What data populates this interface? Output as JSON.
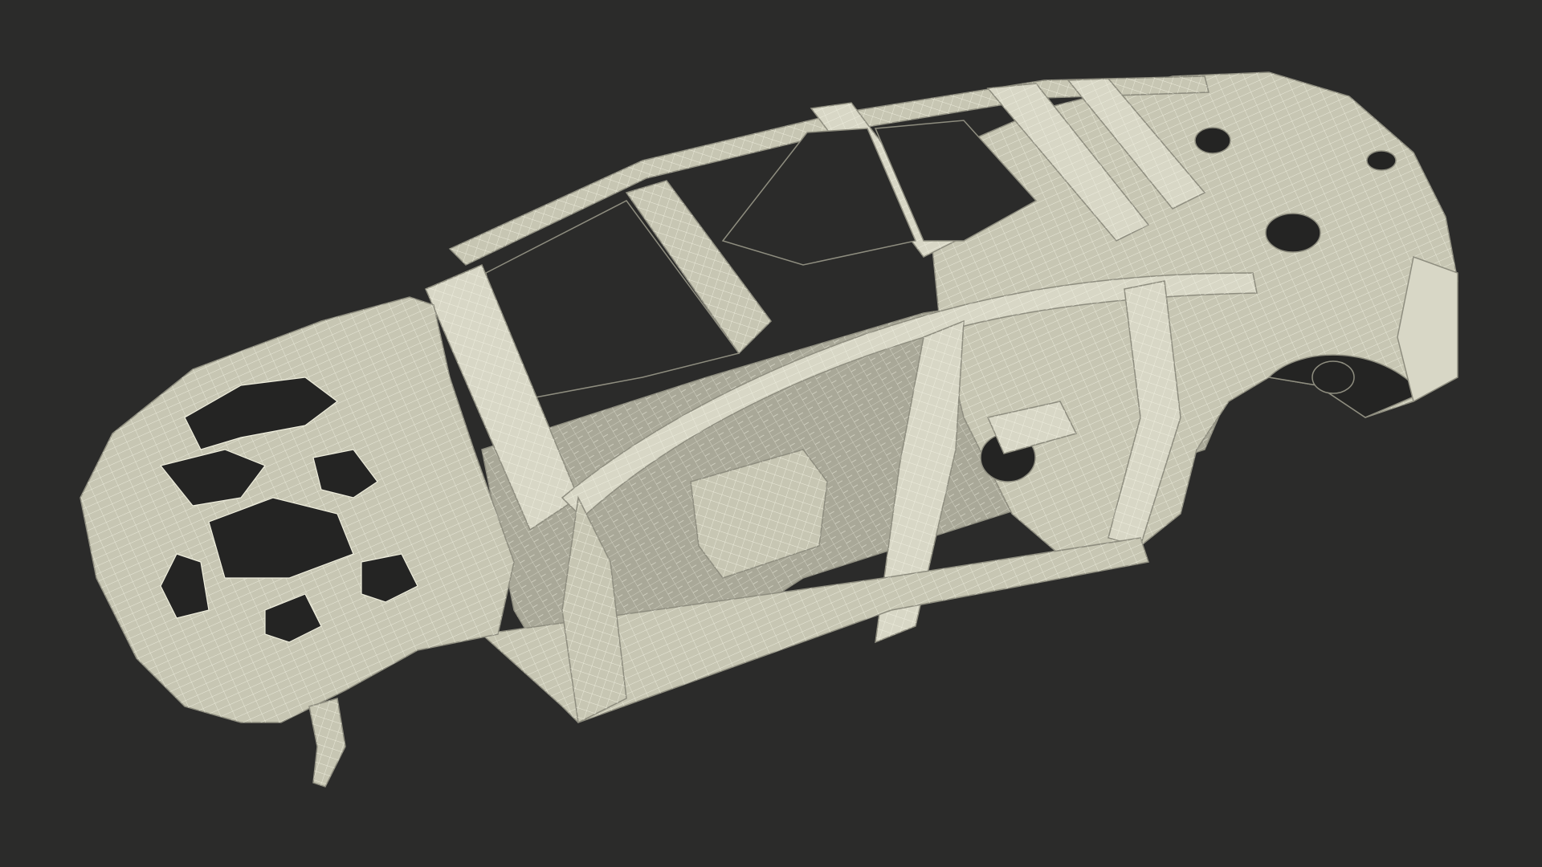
{
  "scene": {
    "subject": "car-body-in-white-wireframe",
    "colors": {
      "background": "#2b2b2a",
      "shell": "#c7c6b3",
      "shell_light": "#d8d7c6",
      "shell_dark": "#8e8d7f",
      "inner": "#a9a898",
      "wire": "#efeedd",
      "cavity": "#242423"
    }
  }
}
